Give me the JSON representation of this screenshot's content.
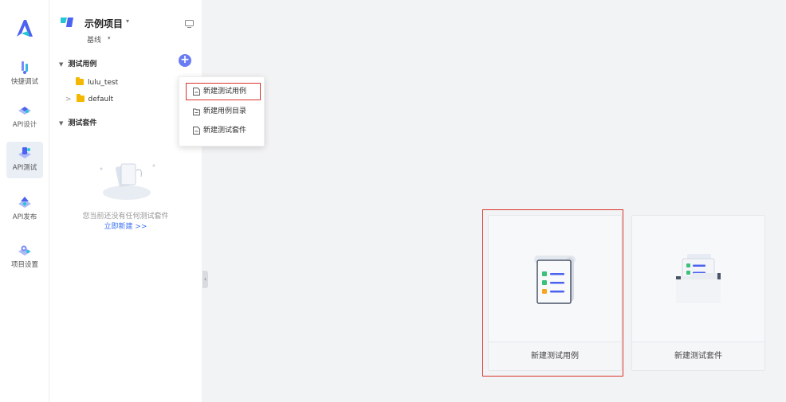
{
  "rail": {
    "items": [
      {
        "label": "快捷调试",
        "icon": "quick-debug-icon"
      },
      {
        "label": "API设计",
        "icon": "api-design-icon"
      },
      {
        "label": "API测试",
        "icon": "api-test-icon",
        "active": true
      },
      {
        "label": "API发布",
        "icon": "api-publish-icon"
      },
      {
        "label": "项目设置",
        "icon": "project-settings-icon"
      }
    ]
  },
  "project": {
    "name": "示例项目",
    "branch": "基线"
  },
  "tree": {
    "cases_header": "测试用例",
    "folders": [
      "lulu_test",
      "default"
    ],
    "suites_header": "测试套件",
    "empty_text": "您当前还没有任何测试套件",
    "empty_link": "立即新建 >>"
  },
  "menu": {
    "items": [
      "新建测试用例",
      "新建用例目录",
      "新建测试套件"
    ]
  },
  "cards": [
    {
      "label": "新建测试用例"
    },
    {
      "label": "新建测试套件"
    }
  ],
  "colors": {
    "accent": "#6a7cf4",
    "link": "#3a6ff5",
    "highlight": "#d9342b",
    "folder": "#f5b800"
  }
}
